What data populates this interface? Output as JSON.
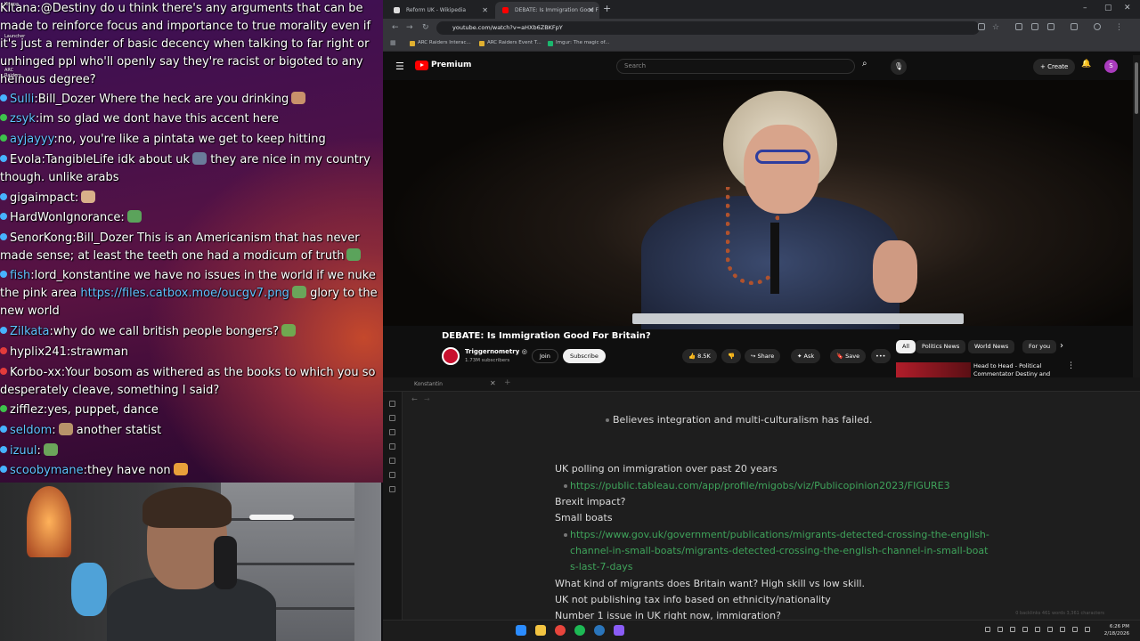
{
  "chat": {
    "messages": [
      {
        "user": "Kitana",
        "user_color": "#ffffff",
        "dot": "none",
        "text": ":@Destiny do u think there's any arguments that can be made to reinforce focus and importance to true morality even if it's just a reminder of basic decency when talking to far right or unhinged ppl who'll openly say they're racist or bigoted to any heinous degree?"
      },
      {
        "user": "Sulli",
        "user_color": "#5fc2ff",
        "dot": "#47b3ff",
        "text": ":Bill_Dozer Where the heck are you drinking"
      },
      {
        "user": "zsyk",
        "user_color": "#5fc2ff",
        "dot": "#3ec24c",
        "text": ":im so glad we dont have this accent here"
      },
      {
        "user": "ayjayyy",
        "user_color": "#5fc2ff",
        "dot": "#3ec24c",
        "text": ":no, you're like a pintata we get to keep hitting"
      },
      {
        "user": "Evola",
        "user_color": "#ffffff",
        "dot": "#47b3ff",
        "text": ":TangibleLife idk about uk",
        "text2": " they are nice in my country though. unlike arabs"
      },
      {
        "user": "gigaimpact",
        "user_color": "#ffffff",
        "dot": "#47b3ff",
        "text": ":"
      },
      {
        "user": "HardWonIgnorance",
        "user_color": "#ffffff",
        "dot": "#47b3ff",
        "text": ":"
      },
      {
        "user": "SenorKong",
        "user_color": "#ffffff",
        "dot": "#47b3ff",
        "text": ":Bill_Dozer This is an Americanism that has never made sense; at least the teeth one had a modicum of truth"
      },
      {
        "user": "fish",
        "user_color": "#5fc2ff",
        "dot": "#47b3ff",
        "text": ":lord_konstantine we have no issues in the world if we nuke the pink area ",
        "link": "https://files.catbox.moe/oucgv7.png",
        "text2": " glory to the new world"
      },
      {
        "user": "Zilkata",
        "user_color": "#5fc2ff",
        "dot": "#47b3ff",
        "text": ":why do we call british people bongers?"
      },
      {
        "user": "hyplix241",
        "user_color": "#ffffff",
        "dot": "#e23b3b",
        "text": ":strawman"
      },
      {
        "user": "Korbo-xx",
        "user_color": "#ffffff",
        "dot": "#e23b3b",
        "text": ":Your bosom as withered as the books to which you so desperately cleave, something I said?"
      },
      {
        "user": "zifflez",
        "user_color": "#ffffff",
        "dot": "#3ec24c",
        "text": ":yes, puppet, dance"
      },
      {
        "user": "seldom",
        "user_color": "#5fc2ff",
        "dot": "#47b3ff",
        "text": ":",
        "text2": " another statist"
      },
      {
        "user": "izuul",
        "user_color": "#5fc2ff",
        "dot": "#47b3ff",
        "text": ":"
      },
      {
        "user": "scoobymane",
        "user_color": "#5fc2ff",
        "dot": "#47b3ff",
        "text": ":they have non"
      }
    ]
  },
  "desktop": {
    "icons": [
      "Kitana",
      "Launcher",
      "ARC Raiders"
    ]
  },
  "browser": {
    "tabs": [
      {
        "title": "Reform UK - Wikipedia",
        "fav_color": "#dddddd"
      },
      {
        "title": "DEBATE: Is Immigration Good F",
        "fav_color": "#ff0000"
      }
    ],
    "close_glyph": "✕",
    "new_tab_glyph": "+",
    "window_controls": [
      "–",
      "▢",
      "✕"
    ],
    "url": "youtube.com/watch?v=aHXb6ZBKFpY",
    "bookmarks": [
      {
        "label": "ARC Raiders Interac...",
        "fav_color": "#e0b030"
      },
      {
        "label": "ARC Raiders Event T...",
        "fav_color": "#e0b030"
      },
      {
        "label": "Imgur: The magic of...",
        "fav_color": "#1bb76e"
      }
    ]
  },
  "youtube": {
    "logo_text": "Premium",
    "search_placeholder": "Search",
    "create_label": "+ Create",
    "avatar_letter": "S",
    "video_title": "DEBATE: Is Immigration Good For Britain?",
    "channel_name": "Triggernometry ◎",
    "channel_subs": "1.73M subscribers",
    "join_label": "Join",
    "subscribe_label": "Subscribe",
    "likes": "8.5K",
    "share_label": "Share",
    "ask_label": "Ask",
    "save_label": "Save",
    "more_label": "•••",
    "chips": [
      "All",
      "Politics News",
      "World News",
      "For you"
    ],
    "rec_title": "Head to Head - Political Commentator Destiny and"
  },
  "notes": {
    "tab_name": "Konstantin",
    "lines": [
      {
        "kind": "text",
        "text": "Believes integration and multi-culturalism has failed.",
        "bullet": true
      },
      {
        "kind": "text",
        "text": "UK polling on immigration over past 20 years"
      },
      {
        "kind": "link",
        "text": "https://public.tableau.com/app/profile/migobs/viz/Publicopinion2023/FIGURE3",
        "bullet": true
      },
      {
        "kind": "text",
        "text": "Brexit impact?"
      },
      {
        "kind": "text",
        "text": "Small boats"
      },
      {
        "kind": "link",
        "text": "https://www.gov.uk/government/publications/migrants-detected-crossing-the-english-",
        "bullet": true
      },
      {
        "kind": "link",
        "text": "channel-in-small-boats/migrants-detected-crossing-the-english-channel-in-small-boat"
      },
      {
        "kind": "link",
        "text": "s-last-7-days"
      },
      {
        "kind": "text",
        "text": "What kind of migrants does Britain want? High skill vs low skill."
      },
      {
        "kind": "text",
        "text": "UK not publishing tax info based on ethnicity/nationality"
      },
      {
        "kind": "text",
        "text": "Number 1 issue in UK right now, immigration?"
      }
    ],
    "status": "0 backlinks   461 words  3,361 characters"
  },
  "taskbar": {
    "time": "6:26 PM",
    "date": "2/18/2026",
    "apps": [
      {
        "name": "start",
        "color": "#2b8cff"
      },
      {
        "name": "explorer",
        "color": "#f3c441"
      },
      {
        "name": "chrome",
        "color": "#e8453c"
      },
      {
        "name": "spotify",
        "color": "#1db954"
      },
      {
        "name": "steam",
        "color": "#2a75bb"
      },
      {
        "name": "obsidian",
        "color": "#8a5cf6"
      }
    ]
  }
}
